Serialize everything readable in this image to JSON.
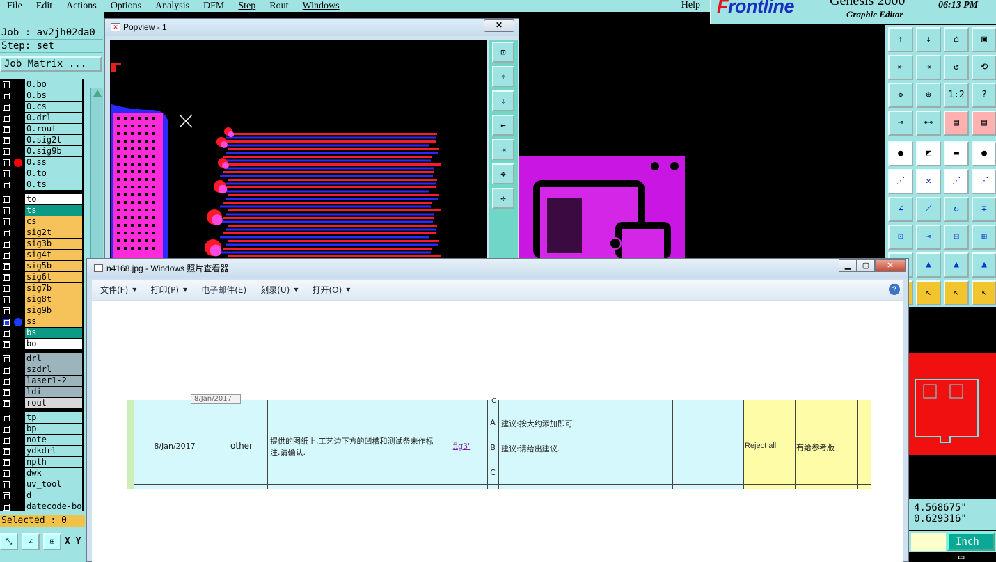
{
  "menu": {
    "items": [
      "File",
      "Edit",
      "Actions",
      "Options",
      "Analysis",
      "DFM",
      "Step",
      "Rout",
      "Windows"
    ],
    "help": "Help"
  },
  "brand": {
    "logo_prefix": "F",
    "logo_rest": "rontline",
    "product": "Genesis 2000",
    "subtitle": "Graphic Editor",
    "clock": "06:13 PM"
  },
  "job": {
    "job_line": "Job : av2jh02da0",
    "step_line": "Step: set",
    "matrix_button": "Job Matrix ..."
  },
  "layers": [
    {
      "name": "0.bo",
      "color": "#9fe3e3"
    },
    {
      "name": "0.bs",
      "color": "#9fe3e3"
    },
    {
      "name": "0.cs",
      "color": "#9fe3e3"
    },
    {
      "name": "0.drl",
      "color": "#9fe3e3"
    },
    {
      "name": "0.rout",
      "color": "#9fe3e3"
    },
    {
      "name": "0.sig2t",
      "color": "#9fe3e3"
    },
    {
      "name": "0.sig9b",
      "color": "#9fe3e3"
    },
    {
      "name": "0.ss",
      "color": "#9fe3e3",
      "dot": "#ff0000"
    },
    {
      "name": "0.to",
      "color": "#9fe3e3"
    },
    {
      "name": "0.ts",
      "color": "#9fe3e3"
    },
    {
      "name": "to",
      "color": "#ffffff"
    },
    {
      "name": "ts",
      "color": "#0a9a86"
    },
    {
      "name": "cs",
      "color": "#f5c35a"
    },
    {
      "name": "sig2t",
      "color": "#f5c35a"
    },
    {
      "name": "sig3b",
      "color": "#f5c35a"
    },
    {
      "name": "sig4t",
      "color": "#f5c35a"
    },
    {
      "name": "sig5b",
      "color": "#f5c35a"
    },
    {
      "name": "sig6t",
      "color": "#f5c35a"
    },
    {
      "name": "sig7b",
      "color": "#f5c35a"
    },
    {
      "name": "sig8t",
      "color": "#f5c35a"
    },
    {
      "name": "sig9b",
      "color": "#f5c35a"
    },
    {
      "name": "ss",
      "color": "#f5c35a",
      "dot": "#1a3cff"
    },
    {
      "name": "bs",
      "color": "#0a9a86"
    },
    {
      "name": "bo",
      "color": "#ffffff"
    },
    {
      "name": "drl",
      "color": "#9cb4bc"
    },
    {
      "name": "szdrl",
      "color": "#9cb4bc"
    },
    {
      "name": "laser1-2",
      "color": "#9cb4bc"
    },
    {
      "name": "ldi",
      "color": "#9cb4bc"
    },
    {
      "name": "rout",
      "color": "#d8d8d8"
    },
    {
      "name": "tp",
      "color": "#9fe3e3"
    },
    {
      "name": "bp",
      "color": "#9fe3e3"
    },
    {
      "name": "note",
      "color": "#9fe3e3"
    },
    {
      "name": "ydkdrl",
      "color": "#9fe3e3"
    },
    {
      "name": "npth",
      "color": "#9fe3e3"
    },
    {
      "name": "dwk",
      "color": "#9fe3e3"
    },
    {
      "name": "uv_tool",
      "color": "#9fe3e3"
    },
    {
      "name": "d",
      "color": "#9fe3e3"
    },
    {
      "name": "datecode-bo",
      "color": "#9fe3e3"
    }
  ],
  "status": {
    "selected": "Selected : 0",
    "xy": "X Y",
    "coord_x": "4.568675\"",
    "coord_y": "0.629316\"",
    "units": "Inch"
  },
  "popview": {
    "title": "Popview - 1",
    "close": "✕"
  },
  "right_icons": [
    "↑",
    "↓",
    "⌂",
    "▣",
    "⇤",
    "⇥",
    "↺",
    "⟲",
    "✥",
    "⊕",
    "1:2",
    "?",
    "⊸",
    "⊷",
    "▤",
    "▤",
    "●",
    "◩",
    "▬",
    "●",
    "⋰",
    "✕",
    "⋰",
    "⋰",
    "∠",
    "⟋",
    "↻",
    "∓",
    "⊡",
    "⊸",
    "⊟",
    "⊞",
    "▲",
    "▲",
    "▲",
    "▲",
    "↖",
    "↖",
    "↖",
    "↖"
  ],
  "photo_viewer": {
    "title": "n4168.jpg - Windows 照片查看器",
    "menu": [
      "文件(F)",
      "打印(P)",
      "电子邮件(E)",
      "刻录(U)",
      "打开(O)"
    ],
    "help": "?",
    "table": {
      "tooltip": "8/Jan/2017",
      "date": "8/Jan/2017",
      "category": "other",
      "description": "提供的图纸上,工艺边下方的凹槽和测试条未作标注.请确认.",
      "figure": "fig3'",
      "options": [
        {
          "letter": "A",
          "text": "建议:按大约添加即可."
        },
        {
          "letter": "B",
          "text": "建议:请给出建议."
        },
        {
          "letter": "C",
          "text": ""
        }
      ],
      "top_letter": "C",
      "decision": "Reject all",
      "remark": "有给参考版"
    }
  }
}
